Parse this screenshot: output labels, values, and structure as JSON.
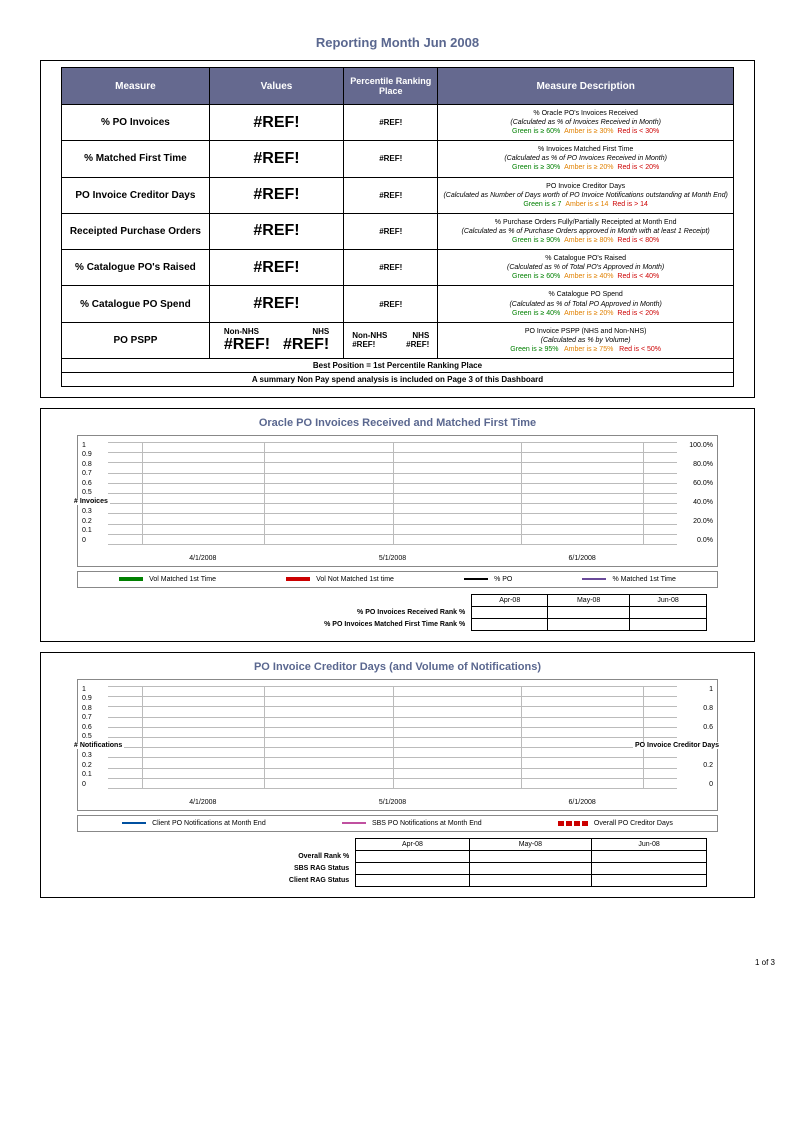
{
  "title": "Reporting Month Jun 2008",
  "page_footer": "1 of 3",
  "headers": {
    "measure": "Measure",
    "values": "Values",
    "percentile": "Percentile Ranking Place",
    "description": "Measure Description"
  },
  "rows": [
    {
      "name": "% PO Invoices",
      "value": "#REF!",
      "rank": "#REF!",
      "desc_line1": "% Oracle PO's Invoices Received",
      "desc_line2": "(Calculated as % of Invoices Received in Month)",
      "green": "Green is ≥ 60%",
      "amber": "Amber is ≥ 30%",
      "red": "Red is < 30%"
    },
    {
      "name": "% Matched First Time",
      "value": "#REF!",
      "rank": "#REF!",
      "desc_line1": "% Invoices Matched First Time",
      "desc_line2": "(Calculated as % of PO Invoices Received in Month)",
      "green": "Green is ≥ 30%",
      "amber": "Amber is ≥ 20%",
      "red": "Red is < 20%"
    },
    {
      "name": "PO Invoice Creditor Days",
      "value": "#REF!",
      "rank": "#REF!",
      "desc_line1": "PO Invoice Creditor Days",
      "desc_line2": "(Calculated as Number of Days worth of PO Invoice Notifications outstanding at Month End)",
      "green": "Green is ≤ 7",
      "amber": "Amber is ≤ 14",
      "red": "Red is > 14"
    },
    {
      "name": "Receipted Purchase Orders",
      "value": "#REF!",
      "rank": "#REF!",
      "desc_line1": "% Purchase Orders Fully/Partially Receipted at Month End",
      "desc_line2": "(Calculated as % of Purchase Orders approved in Month with at least 1 Receipt)",
      "green": "Green is ≥ 90%",
      "amber": "Amber is ≥ 80%",
      "red": "Red is < 80%"
    },
    {
      "name": "% Catalogue PO's Raised",
      "value": "#REF!",
      "rank": "#REF!",
      "desc_line1": "% Catalogue PO's Raised",
      "desc_line2": "(Calculated as % of Total PO's Approved in Month)",
      "green": "Green is ≥ 60%",
      "amber": "Amber is ≥ 40%",
      "red": "Red is < 40%"
    },
    {
      "name": "% Catalogue PO Spend",
      "value": "#REF!",
      "rank": "#REF!",
      "desc_line1": "% Catalogue PO Spend",
      "desc_line2": "(Calculated as % of Total PO Approved in Month)",
      "green": "Green is ≥ 40%",
      "amber": "Amber is ≥ 20%",
      "red": "Red is < 20%"
    }
  ],
  "pspp": {
    "name": "PO PSPP",
    "h_nonnhs": "Non-NHS",
    "h_nhs": "NHS",
    "v_nonnhs": "#REF!",
    "v_nhs": "#REF!",
    "r_nonnhs": "#REF!",
    "r_nhs": "#REF!",
    "desc_line1": "PO Invoice PSPP (NHS and Non-NHS)",
    "desc_line2": "(Calculated as % by Volume)",
    "green": "Green is ≥ 95%",
    "amber": "Amber is ≥ 75%",
    "red": "Red is < 50%"
  },
  "footer1": "Best Position = 1st Percentile Ranking Place",
  "footer2": "A summary Non Pay spend analysis is included on Page 3 of this Dashboard",
  "chart1": {
    "title": "Oracle PO Invoices Received and Matched First Time",
    "yleft": [
      "1",
      "0.9",
      "0.8",
      "0.7",
      "0.6",
      "0.5",
      "0.4",
      "0.3",
      "0.2",
      "0.1",
      "0"
    ],
    "yright": [
      "100.0%",
      "80.0%",
      "60.0%",
      "40.0%",
      "20.0%",
      "0.0%"
    ],
    "x": [
      "4/1/2008",
      "5/1/2008",
      "6/1/2008"
    ],
    "ylabel_left": "# Invoices",
    "legend": [
      "Vol Matched 1st Time",
      "Vol Not Matched 1st time",
      "% PO",
      "% Matched 1st Time"
    ],
    "mini_headers": [
      "Apr-08",
      "May-08",
      "Jun-08"
    ],
    "mini_rows": [
      "% PO Invoices Received Rank %",
      "% PO Invoices Matched First Time Rank %"
    ]
  },
  "chart2": {
    "title": "PO Invoice Creditor Days (and Volume of Notifications)",
    "yleft": [
      "1",
      "0.9",
      "0.8",
      "0.7",
      "0.6",
      "0.5",
      "0.4",
      "0.3",
      "0.2",
      "0.1",
      "0"
    ],
    "yright": [
      "1",
      "0.8",
      "0.6",
      "0.4",
      "0.2",
      "0"
    ],
    "x": [
      "4/1/2008",
      "5/1/2008",
      "6/1/2008"
    ],
    "ylabel_left": "# Notifications",
    "ylabel_right": "PO Invoice Creditor Days",
    "legend": [
      "Client PO Notifications at Month End",
      "SBS PO Notifications at Month End",
      "Overall PO Creditor Days"
    ],
    "mini_headers": [
      "Apr-08",
      "May-08",
      "Jun-08"
    ],
    "mini_rows": [
      "Overall Rank %",
      "SBS RAG Status",
      "Client RAG Status"
    ]
  },
  "chart_data": [
    {
      "type": "bar",
      "title": "Oracle PO Invoices Received and Matched First Time",
      "x": [
        "4/1/2008",
        "5/1/2008",
        "6/1/2008"
      ],
      "series": [
        {
          "name": "Vol Matched 1st Time",
          "values": [
            null,
            null,
            null
          ]
        },
        {
          "name": "Vol Not Matched 1st time",
          "values": [
            null,
            null,
            null
          ]
        },
        {
          "name": "% PO",
          "values": [
            null,
            null,
            null
          ]
        },
        {
          "name": "% Matched 1st Time",
          "values": [
            null,
            null,
            null
          ]
        }
      ],
      "ylabel": "# Invoices",
      "ylim": [
        0,
        1
      ],
      "y2label": "%",
      "y2lim": [
        0,
        100
      ]
    },
    {
      "type": "bar",
      "title": "PO Invoice Creditor Days (and Volume of Notifications)",
      "x": [
        "4/1/2008",
        "5/1/2008",
        "6/1/2008"
      ],
      "series": [
        {
          "name": "Client PO Notifications at Month End",
          "values": [
            null,
            null,
            null
          ]
        },
        {
          "name": "SBS PO Notifications at Month End",
          "values": [
            null,
            null,
            null
          ]
        },
        {
          "name": "Overall PO Creditor Days",
          "values": [
            null,
            null,
            null
          ]
        }
      ],
      "ylabel": "# Notifications",
      "ylim": [
        0,
        1
      ],
      "y2label": "PO Invoice Creditor Days",
      "y2lim": [
        0,
        1
      ]
    }
  ]
}
